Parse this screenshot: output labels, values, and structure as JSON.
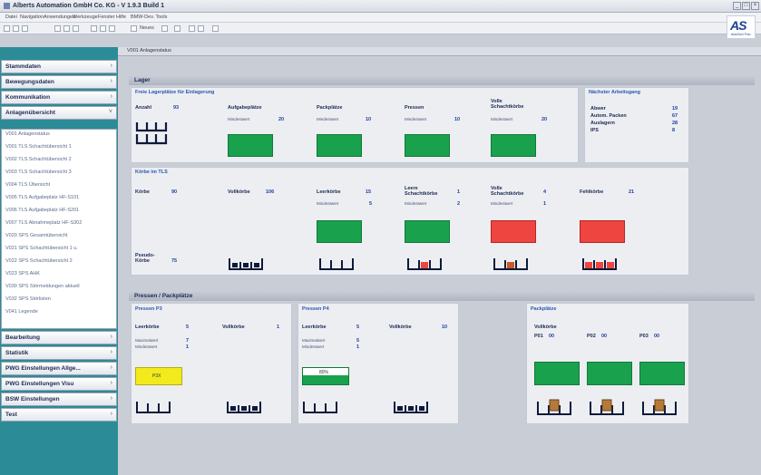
{
  "window": {
    "title": "Alberts Automation GmbH Co. KG - V 1.9.3 Build 1"
  },
  "menu": [
    "Datei",
    "Navigation",
    "Anwendungen",
    "Werkzeuge",
    "Fenster",
    "Hilfe",
    "BMW-Dev. Tools"
  ],
  "toolbar": {
    "new_label": "Neues",
    "logo_text": "AS",
    "logo_sub": "AutoSort Polo"
  },
  "sidebar": {
    "top_buttons": [
      "Stammdaten",
      "Bewegungsdaten",
      "Kommunikation",
      "Anlagenübersicht"
    ],
    "list_items": [
      "V001 Anlagenstatus",
      "V001 TLS Schachtübersicht 1",
      "V002 TLS Schachtübersicht 2",
      "V003 TLS Schachtübersicht 3",
      "V004 TLS Übersicht",
      "V005 TLS Aufgabeplatz HF-S101",
      "V006 TLS Aufgabeplatz HF-S201",
      "V007 TLS Abnahmeplatz HF-S302",
      "V020 SPS Gesamtübersicht",
      "V021 SPS Schachtübersicht 1 u.",
      "V022 SPS Schachtübersicht 2",
      "V023 SPS AHK",
      "V030 SPS Störmeldungen aktuell",
      "V032 SPS Störlisten",
      "V041 Legende"
    ],
    "bottom_buttons": [
      "Bearbeitung",
      "Statistik",
      "PWG Einstellungen Allge...",
      "PWG Einstellungen Visu",
      "BSW Einstellungen",
      "Test"
    ]
  },
  "tab": {
    "label": "V001 Anlagenstatus"
  },
  "lager": {
    "header": "Lager",
    "leer": {
      "title": "Freie Lagerplätze für Einlagerung",
      "anzahl_label": "Anzahl",
      "anzahl_value": "93",
      "cols": [
        {
          "label": "Aufgabeplätze",
          "sub": "Mindestwert",
          "value": "20"
        },
        {
          "label": "Packplätze",
          "sub": "Mindestwert",
          "value": "10"
        },
        {
          "label": "Pressen",
          "sub": "Mindestwert",
          "value": "10"
        },
        {
          "label": "Volle Schachtkörbe",
          "sub": "Mindestwert",
          "value": "20"
        }
      ]
    },
    "next": {
      "title": "Nächster Arbeitsgang",
      "rows": [
        {
          "label": "Abwer",
          "value": "19"
        },
        {
          "label": "Autom. Packen",
          "value": "67"
        },
        {
          "label": "Auslagern",
          "value": "28"
        },
        {
          "label": "IPS",
          "value": "8"
        }
      ]
    }
  },
  "koerbe": {
    "title": "Körbe im TLS",
    "koerbe_label": "Körbe",
    "koerbe_value": "90",
    "vollkoerbe_label": "Vollkörbe",
    "vollkoerbe_value": "106",
    "cols": [
      {
        "label": "Leerkörbe",
        "value": "15",
        "sub": "Mindestwert",
        "subvalue": "5",
        "status": "green"
      },
      {
        "label": "Leere Schachtkörbe",
        "value": "1",
        "sub": "Mindestwert",
        "subvalue": "2",
        "status": "green"
      },
      {
        "label": "Volle Schachtkörbe",
        "value": "4",
        "sub": "Mindestwert",
        "subvalue": "1",
        "status": "red"
      },
      {
        "label": "Fehlkörbe",
        "value": "21",
        "sub": "",
        "subvalue": "",
        "status": "red"
      }
    ],
    "pseudo_label": "Pseudo-Körbe",
    "pseudo_value": "75"
  },
  "pressen": {
    "header": "Pressen / Packplätze",
    "p3": {
      "title": "Pressen P3",
      "leer_label": "Leerkörbe",
      "leer_value": "5",
      "voll_label": "Vollkörbe",
      "voll_value": "1",
      "lines": [
        "Maximalwert",
        "Mindestwert"
      ],
      "values": [
        "7",
        "1"
      ],
      "indicator": "P3X"
    },
    "p4": {
      "title": "Pressen P4",
      "leer_label": "Leerkörbe",
      "leer_value": "5",
      "voll_label": "Vollkörbe",
      "voll_value": "10",
      "lines": [
        "Maximalwert",
        "Mindestwert"
      ],
      "values": [
        "5",
        "1"
      ],
      "indicator": "80%"
    },
    "pack": {
      "title": "Packplätze",
      "vollkoerbe_label": "Vollkörbe",
      "items": [
        {
          "label": "P01",
          "value": "00"
        },
        {
          "label": "P02",
          "value": "00"
        },
        {
          "label": "P03",
          "value": "00"
        }
      ]
    }
  },
  "colors": {
    "green": "#1aa14e",
    "red": "#ee4540",
    "yellow": "#f3ea1e",
    "sidebar": "#2b8c97",
    "accent": "#2a56b0"
  }
}
